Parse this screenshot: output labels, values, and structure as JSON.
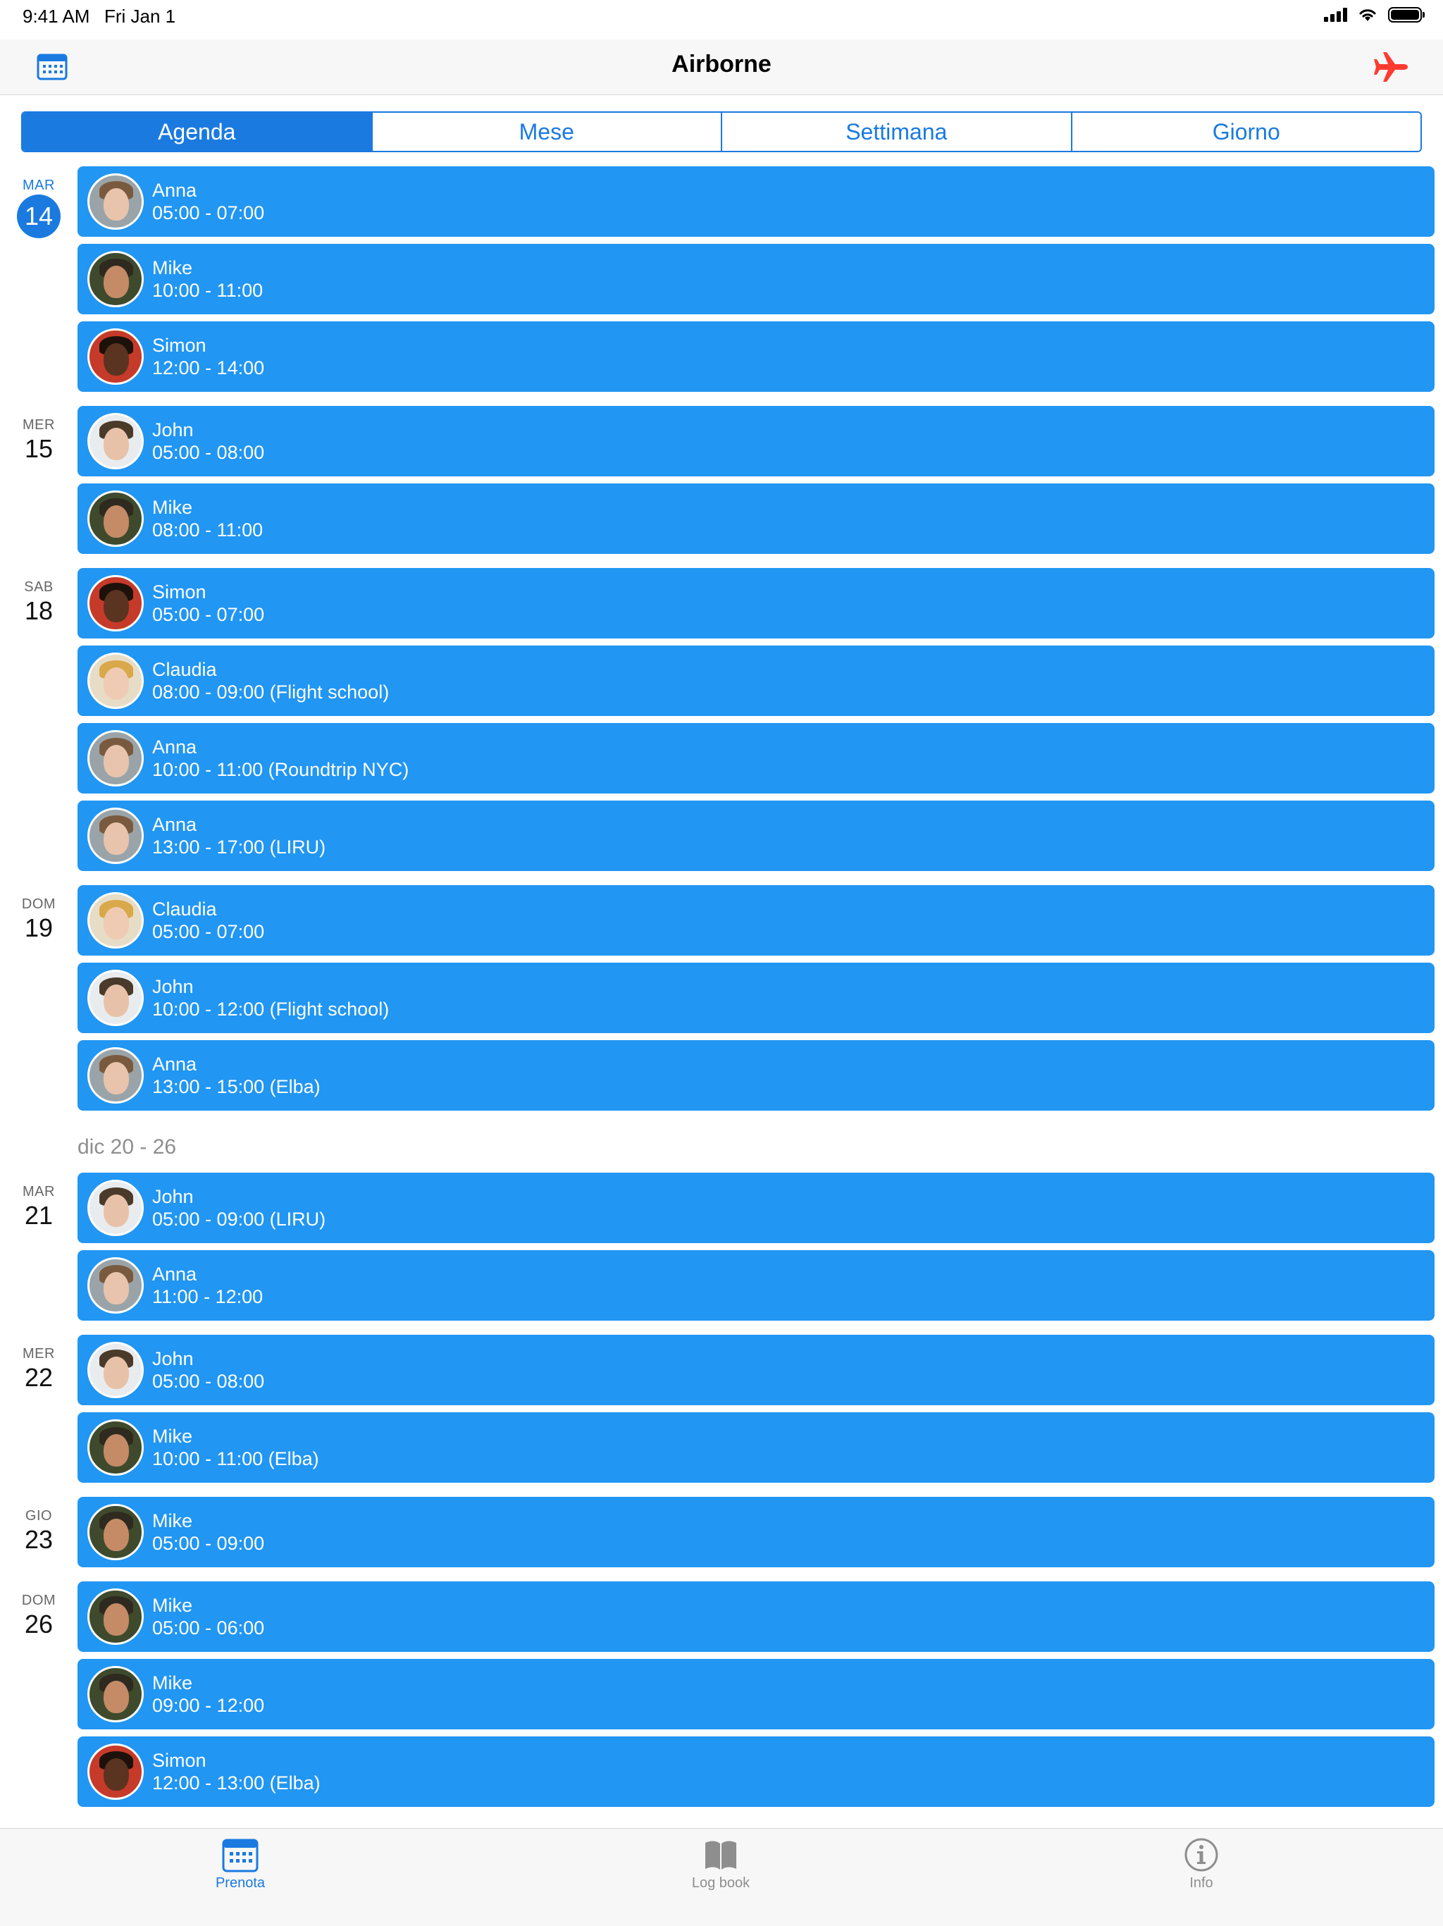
{
  "status_bar": {
    "time": "9:41 AM",
    "date": "Fri Jan 1",
    "battery_level": 1.0
  },
  "nav": {
    "title": "Airborne",
    "left_icon": "calendar-icon",
    "right_icon": "airplane-icon"
  },
  "tabs": [
    {
      "label": "Agenda",
      "active": true
    },
    {
      "label": "Mese",
      "active": false
    },
    {
      "label": "Settimana",
      "active": false
    },
    {
      "label": "Giorno",
      "active": false
    }
  ],
  "week_header": "dic 20 - 26",
  "days": [
    {
      "weekday": "MAR",
      "day": "14",
      "today": true,
      "events": [
        {
          "name": "Anna",
          "time": "05:00 - 07:00",
          "avatar": "anna"
        },
        {
          "name": "Mike",
          "time": "10:00 - 11:00",
          "avatar": "mike"
        },
        {
          "name": "Simon",
          "time": "12:00 - 14:00",
          "avatar": "simon"
        }
      ]
    },
    {
      "weekday": "MER",
      "day": "15",
      "events": [
        {
          "name": "John",
          "time": "05:00 - 08:00",
          "avatar": "john"
        },
        {
          "name": "Mike",
          "time": "08:00 - 11:00",
          "avatar": "mike"
        }
      ]
    },
    {
      "weekday": "SAB",
      "day": "18",
      "events": [
        {
          "name": "Simon",
          "time": "05:00 - 07:00",
          "avatar": "simon"
        },
        {
          "name": "Claudia",
          "time": "08:00 - 09:00 (Flight school)",
          "avatar": "claudia"
        },
        {
          "name": "Anna",
          "time": "10:00 - 11:00 (Roundtrip NYC)",
          "avatar": "anna"
        },
        {
          "name": "Anna",
          "time": "13:00 - 17:00 (LIRU)",
          "avatar": "anna"
        }
      ]
    },
    {
      "weekday": "DOM",
      "day": "19",
      "events": [
        {
          "name": "Claudia",
          "time": "05:00 - 07:00",
          "avatar": "claudia"
        },
        {
          "name": "John",
          "time": "10:00 - 12:00 (Flight school)",
          "avatar": "john"
        },
        {
          "name": "Anna",
          "time": "13:00 - 15:00 (Elba)",
          "avatar": "anna"
        }
      ]
    },
    {
      "weekday": "MAR",
      "day": "21",
      "week_break": true,
      "events": [
        {
          "name": "John",
          "time": "05:00 - 09:00 (LIRU)",
          "avatar": "john"
        },
        {
          "name": "Anna",
          "time": "11:00 - 12:00",
          "avatar": "anna"
        }
      ]
    },
    {
      "weekday": "MER",
      "day": "22",
      "events": [
        {
          "name": "John",
          "time": "05:00 - 08:00",
          "avatar": "john"
        },
        {
          "name": "Mike",
          "time": "10:00 - 11:00 (Elba)",
          "avatar": "mike"
        }
      ]
    },
    {
      "weekday": "GIO",
      "day": "23",
      "events": [
        {
          "name": "Mike",
          "time": "05:00 - 09:00",
          "avatar": "mike"
        }
      ]
    },
    {
      "weekday": "DOM",
      "day": "26",
      "events": [
        {
          "name": "Mike",
          "time": "05:00 - 06:00",
          "avatar": "mike"
        },
        {
          "name": "Mike",
          "time": "09:00 - 12:00",
          "avatar": "mike"
        },
        {
          "name": "Simon",
          "time": "12:00 - 13:00 (Elba)",
          "avatar": "simon"
        }
      ]
    }
  ],
  "tab_bar": [
    {
      "label": "Prenota",
      "icon": "calendar-icon",
      "active": true
    },
    {
      "label": "Log book",
      "icon": "book-icon",
      "active": false
    },
    {
      "label": "Info",
      "icon": "info-icon",
      "active": false
    }
  ],
  "colors": {
    "accent": "#1a7ae0",
    "event_bg": "#2196f3",
    "airplane": "#ff3b30"
  }
}
